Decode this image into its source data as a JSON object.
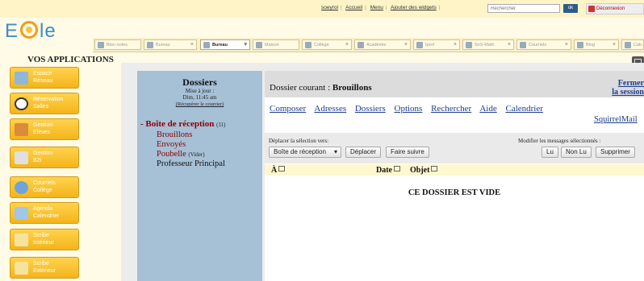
{
  "topbar": {
    "links": [
      "soeyrol",
      "Accueil",
      "Menu",
      "Ajouter des widgets"
    ],
    "search_placeholder": "Rechercher",
    "ok_label": "ok",
    "disconnect_label": "Déconnexion"
  },
  "logo": {
    "text_e": "E",
    "text_le": "le"
  },
  "tabs": [
    {
      "label": "Bloc-notes",
      "active": false
    },
    {
      "label": "Bureau",
      "active": false
    },
    {
      "label": "Bureau",
      "active": true
    },
    {
      "label": "Maison",
      "active": false
    },
    {
      "label": "Collège",
      "active": false
    },
    {
      "label": "Académie",
      "active": false
    },
    {
      "label": "Iprof",
      "active": false
    },
    {
      "label": "SoS-Math",
      "active": false
    },
    {
      "label": "Courriels",
      "active": false
    },
    {
      "label": "Blog",
      "active": false
    },
    {
      "label": "Calc",
      "active": false
    }
  ],
  "apps": {
    "title": "VOS APPLICATIONS",
    "items": [
      {
        "line1": "Espace",
        "line2": "Réseau",
        "icon": "network-folder-icon",
        "color": "#8fb7d9"
      },
      {
        "line1": "Réservation",
        "line2": "Salles",
        "icon": "reservation-icon",
        "color": "#333333"
      },
      {
        "line1": "Gestion",
        "line2": "Elèves",
        "icon": "students-icon",
        "color": "#d98c3a"
      },
      {
        "line1": "Gestion",
        "line2": "B2i",
        "icon": "b2i-icon",
        "color": "#e0e0e0"
      },
      {
        "line1": "Courriels",
        "line2": "Collège",
        "icon": "mail-icon",
        "color": "#6fa4d8"
      },
      {
        "line1": "Agenda",
        "line2": "Calendrier",
        "icon": "calendar-icon",
        "color": "#a0c6e8"
      },
      {
        "line1": "Scribe",
        "line2": "Intérieur",
        "icon": "scribe-icon",
        "color": "#f7e3a0"
      },
      {
        "line1": "Scribe",
        "line2": "Extérieur",
        "icon": "scribe-icon",
        "color": "#f7e3a0"
      }
    ]
  },
  "folders": {
    "title": "Dossiers",
    "updated_label": "Mise à jour :",
    "updated_time": "Dim, 11:45 am",
    "retrieve_link": "(Récupérer le courrier)",
    "inbox": {
      "bullet": "- ",
      "label": "Boîte de réception",
      "count": "(11)"
    },
    "subfolders": [
      {
        "label": "Brouillons",
        "extra": ""
      },
      {
        "label": "Envoyés",
        "extra": ""
      },
      {
        "label": "Poubelle",
        "extra": "(Vider)"
      },
      {
        "label": "Professeur Principal",
        "extra": ""
      }
    ]
  },
  "mail": {
    "current_prefix": "Dossier courant : ",
    "current_folder": "Brouillons",
    "close_session": "Fermer la session",
    "menu": [
      "Composer",
      "Adresses",
      "Dossiers",
      "Options",
      "Rechercher",
      "Aide",
      "Calendrier"
    ],
    "squirrel": "SquirrelMail",
    "move_label": "Déplacer la sélection vers:",
    "move_select": "Boîte de réception",
    "move_button": "Déplacer",
    "forward_button": "Faire suivre",
    "modify_label": "Modifier les messages sélectionnés :",
    "read_button": "Lu",
    "unread_button": "Non Lu",
    "delete_button": "Supprimer",
    "col_to": "À",
    "col_date": "Date",
    "col_subject": "Objet",
    "empty_message": "CE DOSSIER EST VIDE"
  }
}
